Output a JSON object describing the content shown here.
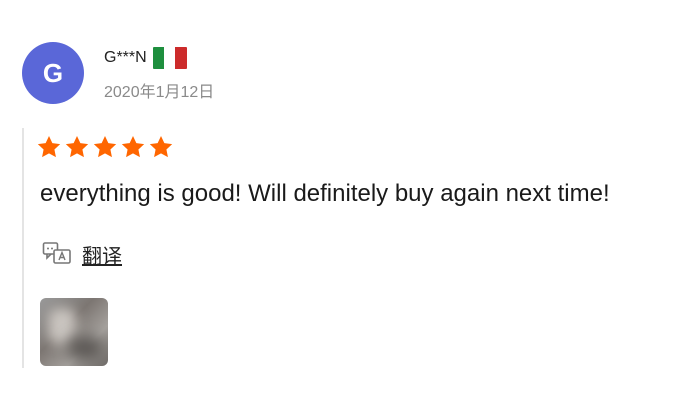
{
  "review": {
    "avatar_initial": "G",
    "avatar_color": "#5a67d8",
    "user_name": "G***N",
    "country_flag": {
      "name": "italy-flag-icon",
      "colors": [
        "#1e8f3e",
        "#ffffff",
        "#cc2b2b"
      ]
    },
    "date": "2020年1月12日",
    "rating": 5,
    "star_color": "#ff6600",
    "text": "everything is good! Will definitely buy again next time!",
    "translate_label": "翻译",
    "photo_icon": "review-photo-thumbnail"
  }
}
